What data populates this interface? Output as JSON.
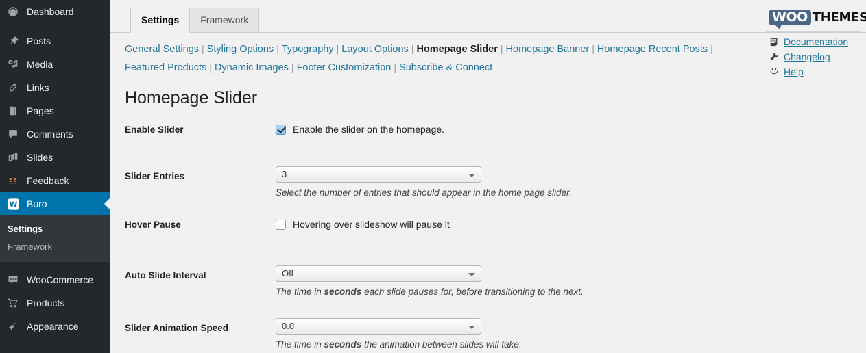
{
  "sidebar": {
    "items": [
      {
        "label": "Dashboard",
        "icon": "dashboard-icon",
        "active": false
      },
      {
        "label": "Posts",
        "icon": "pin-icon",
        "active": false
      },
      {
        "label": "Media",
        "icon": "media-icon",
        "active": false
      },
      {
        "label": "Links",
        "icon": "link-icon",
        "active": false
      },
      {
        "label": "Pages",
        "icon": "pages-icon",
        "active": false
      },
      {
        "label": "Comments",
        "icon": "comment-icon",
        "active": false
      },
      {
        "label": "Slides",
        "icon": "slides-icon",
        "active": false
      },
      {
        "label": "Feedback",
        "icon": "feedback-icon",
        "active": false
      },
      {
        "label": "Buro",
        "icon": "w-badge-icon",
        "active": true
      }
    ],
    "submenu": [
      {
        "label": "Settings",
        "current": true
      },
      {
        "label": "Framework",
        "current": false
      }
    ],
    "items_after": [
      {
        "label": "WooCommerce",
        "icon": "woocommerce-icon",
        "active": false
      },
      {
        "label": "Products",
        "icon": "cart-icon",
        "active": false
      },
      {
        "label": "Appearance",
        "icon": "paintbrush-icon",
        "active": false
      }
    ],
    "active_color": "#0073aa",
    "background": "#23282d",
    "submenu_background": "#32373c"
  },
  "tabs": [
    {
      "label": "Settings",
      "active": true
    },
    {
      "label": "Framework",
      "active": false
    }
  ],
  "subnav": {
    "row1": [
      {
        "label": "General Settings",
        "current": false
      },
      {
        "label": "Styling Options",
        "current": false
      },
      {
        "label": "Typography",
        "current": false
      },
      {
        "label": "Layout Options",
        "current": false
      },
      {
        "label": "Homepage Slider",
        "current": true
      },
      {
        "label": "Homepage Banner",
        "current": false
      },
      {
        "label": "Homepage Recent Posts",
        "current": false
      }
    ],
    "row2": [
      {
        "label": "Featured Products",
        "current": false
      },
      {
        "label": "Dynamic Images",
        "current": false
      },
      {
        "label": "Footer Customization",
        "current": false
      },
      {
        "label": "Subscribe & Connect",
        "current": false
      }
    ],
    "separator": "|",
    "link_color": "#21759b"
  },
  "page": {
    "title": "Homepage Slider"
  },
  "form": {
    "rows": [
      {
        "label": "Enable Slider",
        "type": "checkbox",
        "checked": true,
        "text": "Enable the slider on the homepage.",
        "hint": null
      },
      {
        "label": "Slider Entries",
        "type": "select",
        "value": "3",
        "hint_prefix": "Select the number of entries that should appear in the home page slider.",
        "hint_bold": null,
        "hint_suffix": null
      },
      {
        "label": "Hover Pause",
        "type": "checkbox",
        "checked": false,
        "text": "Hovering over slideshow will pause it",
        "hint": null
      },
      {
        "label": "Auto Slide Interval",
        "type": "select",
        "value": "Off",
        "hint_prefix": "The time in ",
        "hint_bold": "seconds",
        "hint_suffix": " each slide pauses for, before transitioning to the next."
      },
      {
        "label": "Slider Animation Speed",
        "type": "select",
        "value": "0.0",
        "hint_prefix": "The time in ",
        "hint_bold": "seconds",
        "hint_suffix": " the animation between slides will take."
      }
    ]
  },
  "branding": {
    "logo_bubble": "WOO",
    "logo_text": "THEMES",
    "logo_color": "#4a6785"
  },
  "helplinks": [
    {
      "label": "Documentation",
      "icon": "document-icon"
    },
    {
      "label": "Changelog",
      "icon": "wrench-icon"
    },
    {
      "label": "Help",
      "icon": "smiley-icon"
    }
  ]
}
